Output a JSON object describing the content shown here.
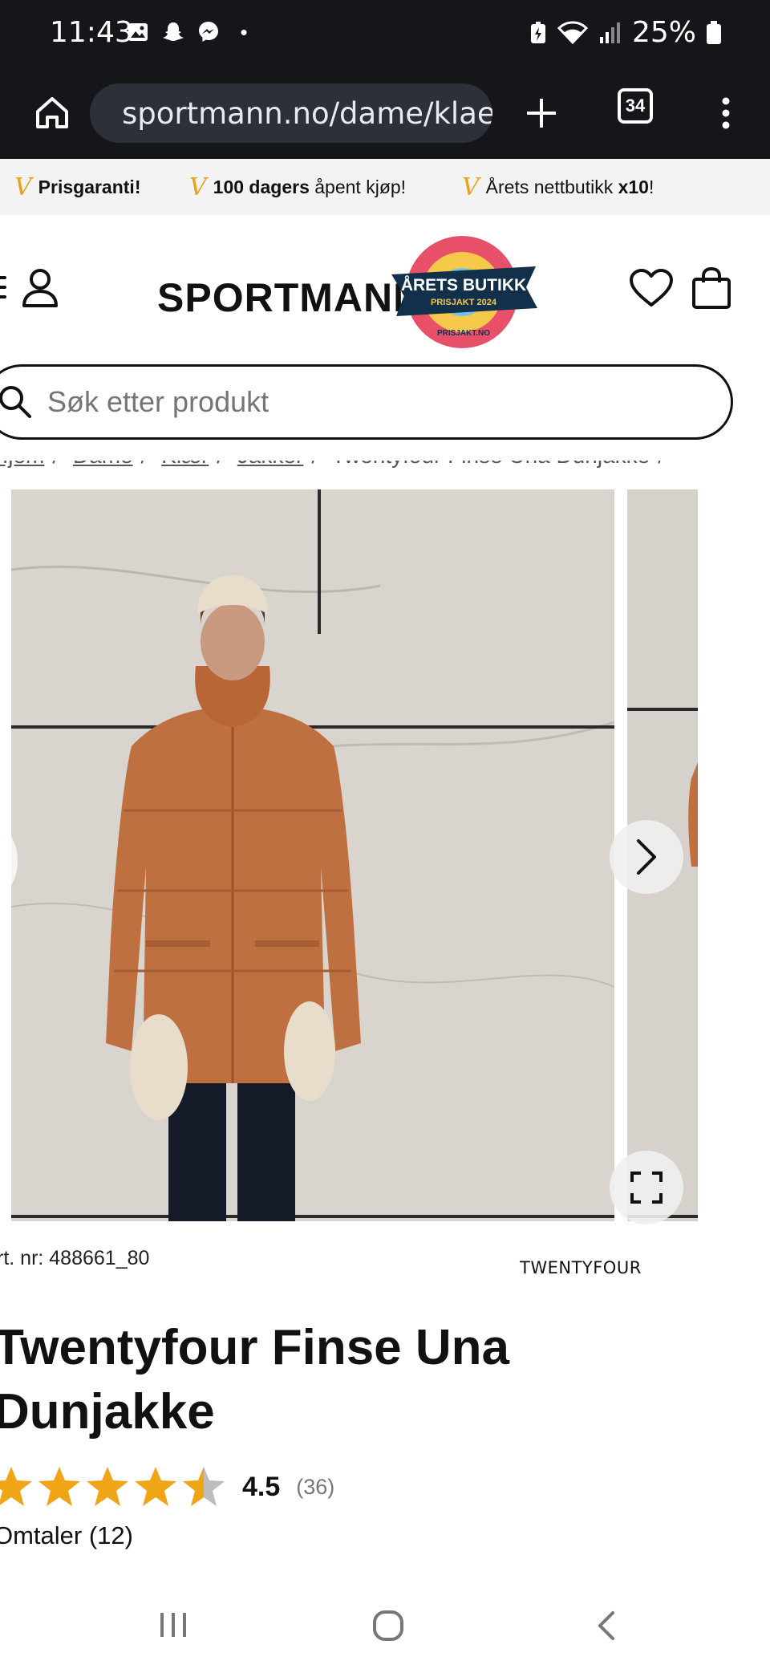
{
  "status_bar": {
    "time": "11:43",
    "dot": "•",
    "battery": "25%",
    "icons": [
      "image-icon",
      "snapchat-icon",
      "messenger-icon",
      "battery-saver-icon",
      "wifi-icon",
      "signal-icon",
      "battery-icon"
    ]
  },
  "browser": {
    "url": "sportmann.no/dame/klaer/jakker",
    "tab_count": "34"
  },
  "promo": {
    "items": [
      {
        "bold": "Prisgaranti!",
        "rest": ""
      },
      {
        "bold": "100 dagers",
        "rest": " åpent kjøp!"
      },
      {
        "rest_before": "Årets nettbutikk ",
        "bold": "x10",
        "rest_after": "!"
      }
    ]
  },
  "header": {
    "logo": "SPORTMANN",
    "badge_title": "ÅRETS BUTIKK",
    "badge_sub": "PRISJAKT 2024",
    "badge_site": "PRISJAKT.NO"
  },
  "search": {
    "placeholder": "Søk etter produkt"
  },
  "breadcrumb": {
    "items": [
      "Hjem",
      "Dame",
      "Klær",
      "Jakker"
    ],
    "current": "Twentyfour Finse Una Dunjakke"
  },
  "product": {
    "art_nr": "rt. nr: 488661_80",
    "brand": "TWENTYFOUR",
    "title": "Twentyfour Finse Una Dunjakke",
    "rating": 4.5,
    "rating_value": "4.5",
    "rating_count": "(36)",
    "reviews": "Omtaler (12)"
  },
  "colors": {
    "accent_gold": "#e8a21a",
    "jacket": "#bf7040",
    "browser_bg": "#15161a"
  }
}
